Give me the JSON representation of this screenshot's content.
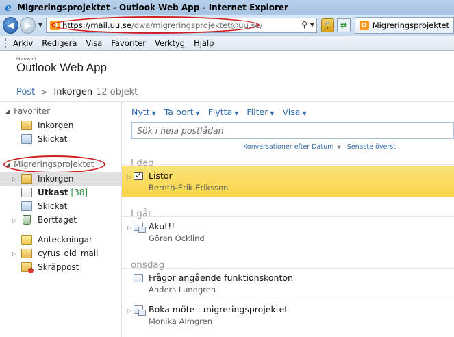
{
  "window": {
    "title": "Migreringsprojektet - Outlook Web App - Internet Explorer"
  },
  "address_bar": {
    "url_host": "https://mail.uu.se",
    "url_path": "/owa/migreringsprojektet@uu.se/",
    "tab_label": "Migreringsprojektet"
  },
  "menu": {
    "items": [
      "Arkiv",
      "Redigera",
      "Visa",
      "Favoriter",
      "Verktyg",
      "Hjälp"
    ]
  },
  "brand": {
    "small": "Microsoft",
    "name": "Outlook Web App"
  },
  "breadcrumb": {
    "root": "Post",
    "separator": ">",
    "folder": "Inkorgen",
    "count": "12 objekt"
  },
  "favorites": {
    "title": "Favoriter",
    "items": [
      "Inkorgen",
      "Skickat"
    ]
  },
  "mailbox": {
    "title": "Migreringsprojektet",
    "folders": {
      "inbox": "Inkorgen",
      "drafts": "Utkast",
      "drafts_count": "[38]",
      "sent": "Skickat",
      "deleted": "Borttaget",
      "notes": "Anteckningar",
      "cyrus": "cyrus_old_mail",
      "junk": "Skräppost"
    }
  },
  "toolbar": {
    "new": "Nytt",
    "delete": "Ta bort",
    "move": "Flytta",
    "filter": "Filter",
    "view": "Visa"
  },
  "search": {
    "placeholder": "Sök i hela postlådan"
  },
  "sort": {
    "by": "Konversationer efter Datum",
    "order": "Senaste överst"
  },
  "groups": {
    "today": "I dag",
    "yesterday": "I går",
    "wednesday": "onsdag"
  },
  "messages": [
    {
      "subject": "Listor",
      "sender": "Bernth-Erik Eriksson"
    },
    {
      "subject": "Akut!!",
      "sender": "Göran Ocklind"
    },
    {
      "subject": "Frågor angående funktionskonton",
      "sender": "Anders Lundgren"
    },
    {
      "subject": "Boka möte - migreringsprojektet",
      "sender": "Monika Almgren"
    }
  ],
  "colors": {
    "link": "#2f6aa8",
    "selection": "#f8d547",
    "annotation": "#d01d1d"
  }
}
